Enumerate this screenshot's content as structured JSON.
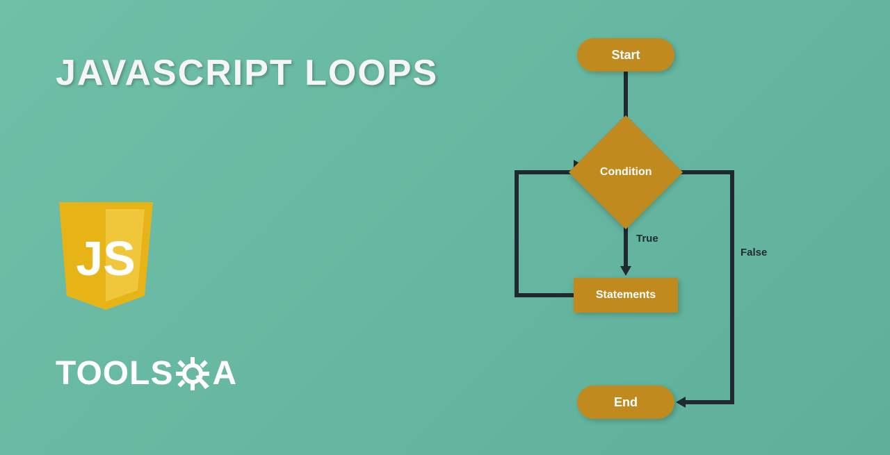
{
  "title": "JAVASCRIPT LOOPS",
  "logos": {
    "js": "JS",
    "brand": "TOOLSQA"
  },
  "flowchart": {
    "nodes": {
      "start": "Start",
      "condition": "Condition",
      "statements": "Statements",
      "end": "End"
    },
    "edges": {
      "true_label": "True",
      "false_label": "False"
    }
  },
  "colors": {
    "node_fill": "#c08a1f",
    "arrow": "#1e2a30",
    "bg_start": "#6fbfa9",
    "bg_end": "#5eb09a"
  }
}
